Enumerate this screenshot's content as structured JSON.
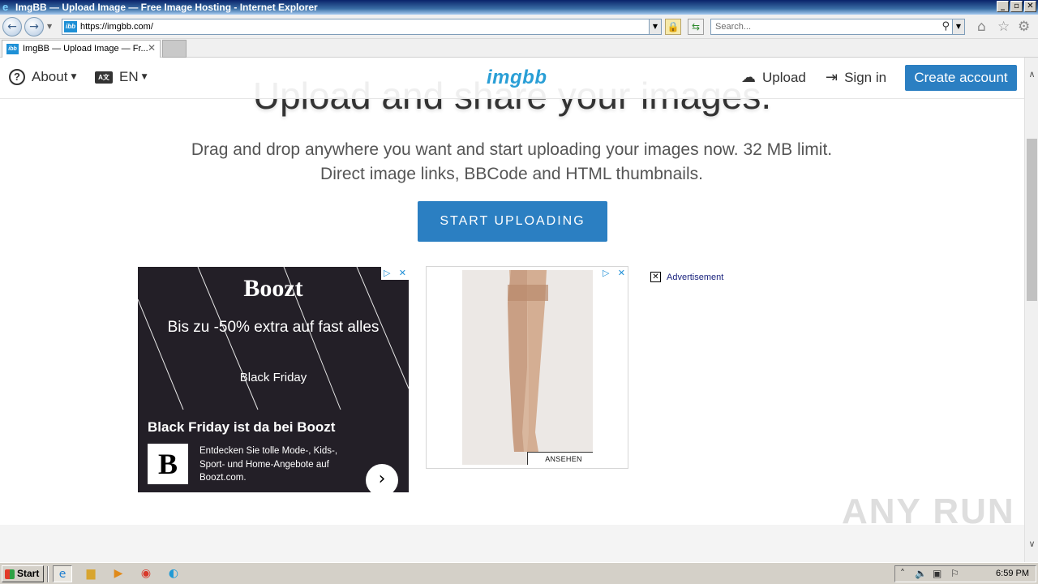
{
  "window": {
    "title": "ImgBB — Upload Image — Free Image Hosting - Internet Explorer",
    "buttons": [
      "_",
      "▫",
      "✕"
    ]
  },
  "toolbar": {
    "url": "https://imgbb.com/",
    "favicon_text": "ibb",
    "search_placeholder": "Search..."
  },
  "tabs": [
    {
      "title": "ImgBB — Upload Image — Fr...",
      "favicon_text": "ibb"
    }
  ],
  "site_header": {
    "about_label": "About",
    "lang_label": "EN",
    "logo_text": "imgbb",
    "upload_label": "Upload",
    "signin_label": "Sign in",
    "create_account_label": "Create account"
  },
  "hero": {
    "title": "Upload and share your images.",
    "subtitle": "Drag and drop anywhere you want and start uploading your images now. 32 MB limit. Direct image links, BBCode and HTML thumbnails.",
    "start_button": "START UPLOADING"
  },
  "ads": {
    "ad1": {
      "brand": "Boozt",
      "headline": "Bis zu -50% extra auf fast alles",
      "sub": "Black Friday",
      "title": "Black Friday ist da bei Boozt",
      "logo_letter": "B",
      "description": "Entdecken Sie tolle Mode-, Kids-, Sport- und Home-Angebote auf Boozt.com."
    },
    "ad2": {
      "button_label": "ANSEHEN"
    },
    "label": "Advertisement"
  },
  "watermark": "ANY RUN",
  "taskbar": {
    "start_label": "Start",
    "clock": "6:59 PM"
  },
  "colors": {
    "brand_blue": "#2b7fc2",
    "logo_blue": "#2a9fd6",
    "ad1_bg": "#231f27"
  }
}
